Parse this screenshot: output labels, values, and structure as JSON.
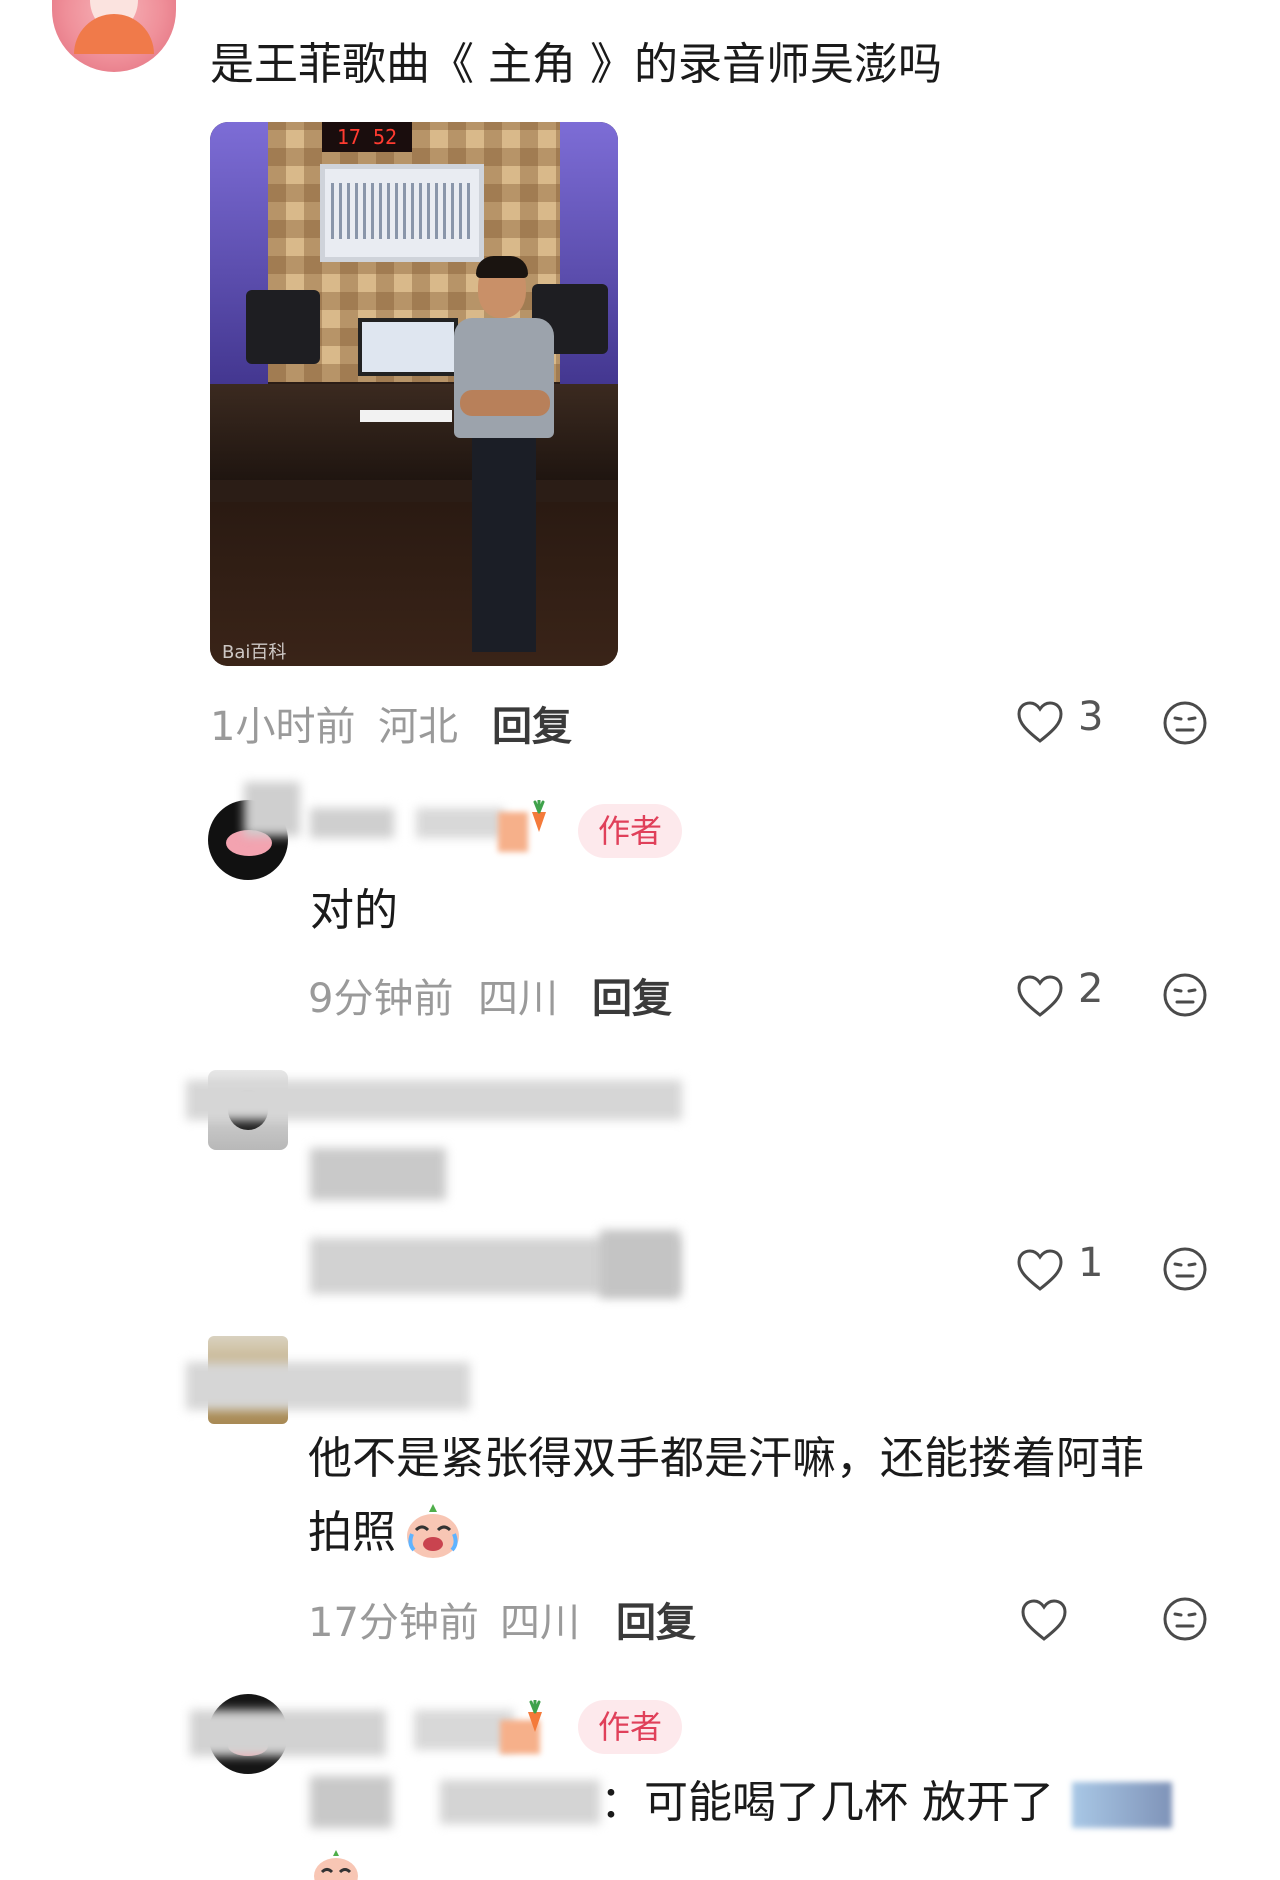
{
  "comments": [
    {
      "text": "是王菲歌曲《 主角  》的录音师吴澎吗",
      "photo_clock": "17 52",
      "photo_watermark": "Bai百科",
      "time": "1小时前",
      "location": "河北",
      "reply": "回复",
      "likes": "3"
    },
    {
      "badge": "作者",
      "text": "对的",
      "time": "9分钟前",
      "location": "四川",
      "reply": "回复",
      "likes": "2"
    },
    {
      "likes": "1"
    },
    {
      "text_line1": "他不是紧张得双手都是汗嘛，还能搂着阿菲",
      "text_line2": "拍照",
      "time": "17分钟前",
      "location": "四川",
      "reply": "回复"
    },
    {
      "badge": "作者",
      "text": "：可能喝了几杯 放开了"
    }
  ],
  "icons": {
    "like": "heart-outline-icon",
    "dislike": "neutral-face-icon",
    "emoji": "crying-laughing-emoji"
  },
  "colors": {
    "badge_bg": "#fde9ec",
    "badge_text": "#e0405a",
    "meta_text": "#9a9a9a",
    "icon_stroke": "#4a4a4a"
  }
}
